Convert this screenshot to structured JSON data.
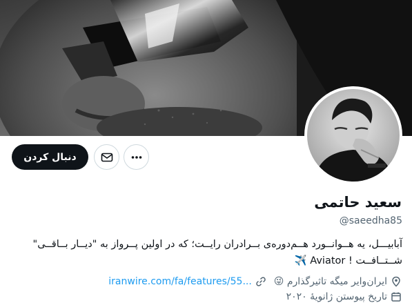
{
  "profile": {
    "name": "سعید حاتمی",
    "handle": "@saeedha85",
    "bio_line1": "آبابیـــل، یه هــوانــورد هــم‌دوره‌ی بــرادران رایــت؛ که در اولین پــرواز به \"دیــار بــاقــی\"",
    "bio_line2": "شــتــافــت ! Aviator ✈️",
    "location": "ایران‌وایر میگه تاثیرگذارم 😜",
    "website": "iranwire.com/fa/features/55...",
    "joined": "تاریخ پیوستن ژانویهٔ ۲۰۲۰"
  },
  "actions": {
    "follow_label": "دنبال کردن",
    "message_icon": "envelope-icon",
    "more_icon": "ellipsis-icon"
  },
  "colors": {
    "follow_bg": "#0f1419",
    "link": "#1d9bf0",
    "secondary_text": "#536471",
    "border": "#cfd9de"
  }
}
